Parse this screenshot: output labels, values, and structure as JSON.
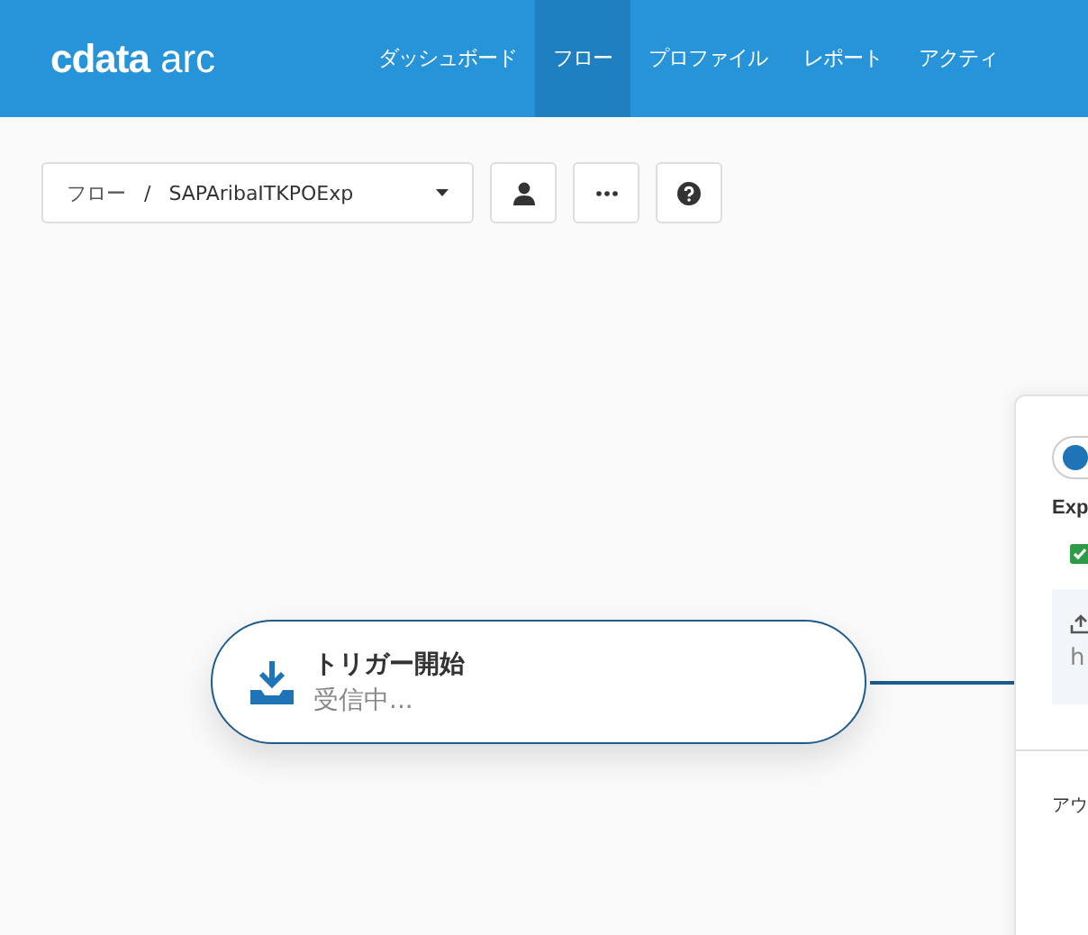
{
  "header": {
    "logo": {
      "mark": "cdata",
      "product": "arc"
    },
    "nav": [
      {
        "label": "ダッシュボード",
        "selected": false
      },
      {
        "label": "フロー",
        "selected": true
      },
      {
        "label": "プロファイル",
        "selected": false
      },
      {
        "label": "レポート",
        "selected": false
      },
      {
        "label": "アクティ",
        "selected": false
      }
    ]
  },
  "toolbar": {
    "breadcrumb": {
      "root": "フロー",
      "separator": "/",
      "current": "SAPAribaITKPOExp"
    }
  },
  "canvas": {
    "node": {
      "title": "トリガー開始",
      "status": "受信中..."
    },
    "panel": {
      "toggle": {
        "on": true
      },
      "heading": "Exp",
      "field_value": "h",
      "footer": "アウ"
    }
  }
}
